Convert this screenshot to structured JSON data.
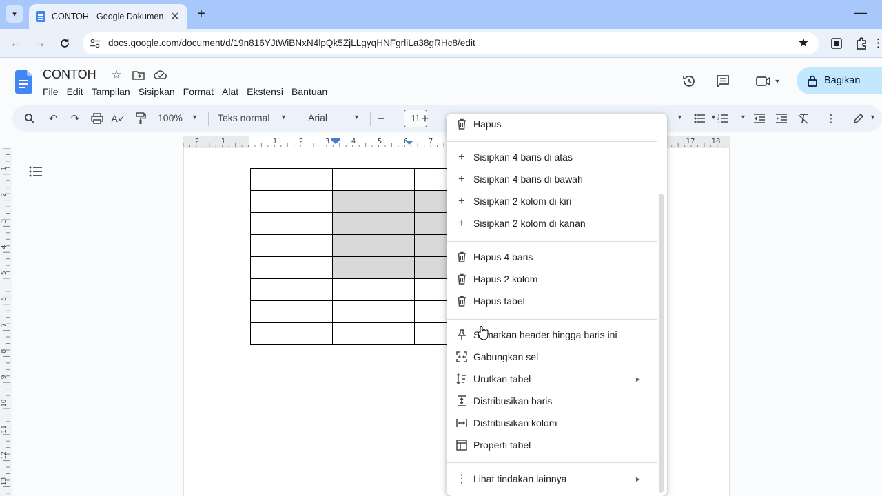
{
  "browser": {
    "tab_title": "CONTOH - Google Dokumen",
    "tab_close": "✕",
    "new_tab": "+",
    "url": "docs.google.com/document/d/19n816YJtWiBNxN4lpQk5ZjLLgyqHNFgrliLa38gRHc8/edit"
  },
  "doc": {
    "title": "CONTOH",
    "menu": [
      "File",
      "Edit",
      "Tampilan",
      "Sisipkan",
      "Format",
      "Alat",
      "Ekstensi",
      "Bantuan"
    ],
    "share_label": "Bagikan"
  },
  "toolbar": {
    "zoom": "100%",
    "style": "Teks normal",
    "font": "Arial",
    "font_size": "11"
  },
  "ruler": {
    "h_left": [
      "2",
      "1",
      "1",
      "2",
      "3",
      "4",
      "5",
      "6",
      "7"
    ],
    "h_right": [
      "17",
      "18"
    ],
    "v": [
      "1",
      "2",
      "3",
      "4",
      "5",
      "6",
      "7",
      "8",
      "9",
      "10",
      "11",
      "12",
      "13"
    ]
  },
  "table": {
    "rows": 8,
    "cols": 3,
    "selected_rows": [
      1,
      2,
      3,
      4
    ],
    "selected_cols": [
      1,
      2
    ]
  },
  "context_menu": {
    "items": [
      {
        "label": "Hapus",
        "icon": "trash-icon"
      },
      {
        "label": "Sisipkan 4 baris di atas",
        "icon": "plus-icon"
      },
      {
        "label": "Sisipkan 4 baris di bawah",
        "icon": "plus-icon"
      },
      {
        "label": "Sisipkan 2 kolom di kiri",
        "icon": "plus-icon"
      },
      {
        "label": "Sisipkan 2 kolom di kanan",
        "icon": "plus-icon"
      },
      {
        "label": "Hapus 4 baris",
        "icon": "trash-icon"
      },
      {
        "label": "Hapus 2 kolom",
        "icon": "trash-icon"
      },
      {
        "label": "Hapus tabel",
        "icon": "trash-icon"
      },
      {
        "label": "Sematkan header hingga baris ini",
        "icon": "pin-icon"
      },
      {
        "label": "Gabungkan sel",
        "icon": "merge-cells-icon"
      },
      {
        "label": "Urutkan tabel",
        "icon": "sort-icon",
        "submenu": true
      },
      {
        "label": "Distribusikan baris",
        "icon": "distribute-rows-icon"
      },
      {
        "label": "Distribusikan kolom",
        "icon": "distribute-columns-icon"
      },
      {
        "label": "Properti tabel",
        "icon": "table-properties-icon"
      },
      {
        "label": "Lihat tindakan lainnya",
        "icon": "more-vert-icon",
        "submenu": true
      }
    ]
  },
  "colors": {
    "tabstrip": "#a8c7fa",
    "toolbar_bg": "#edf2fa",
    "share_bg": "#c2e7ff",
    "docs_blue": "#4285f4",
    "cell_selected": "#d9d9d9"
  }
}
